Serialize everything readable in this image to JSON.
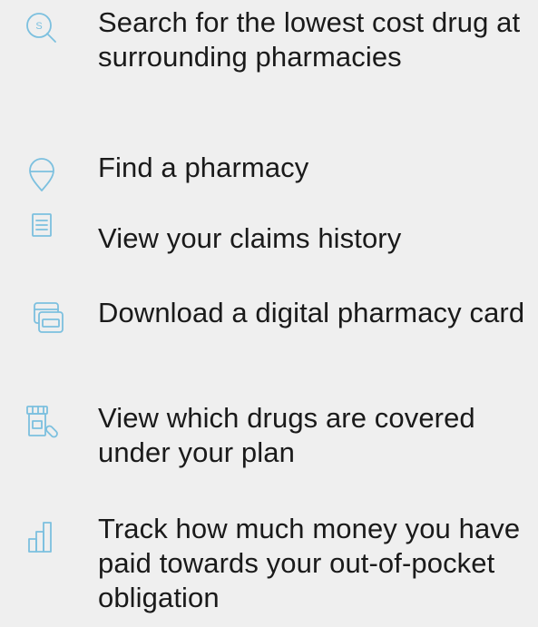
{
  "features": [
    {
      "label": "Search for the lowest cost drug at surrounding pharmacies",
      "icon": "search-price-icon"
    },
    {
      "label": "Find a pharmacy",
      "icon": "map-pin-icon"
    },
    {
      "label": "View your claims history",
      "icon": "document-list-icon"
    },
    {
      "label": "Download a digital pharmacy card",
      "icon": "pharmacy-card-icon"
    },
    {
      "label": "View which drugs are covered under your plan",
      "icon": "pill-bottle-icon"
    },
    {
      "label": "Track how much money you have paid towards your out-of-pocket obligation",
      "icon": "bar-chart-icon"
    }
  ],
  "search_icon_symbol": "S",
  "colors": {
    "background": "#efefef",
    "text": "#1a1a1a",
    "icon_accent": "#7cc0df"
  }
}
